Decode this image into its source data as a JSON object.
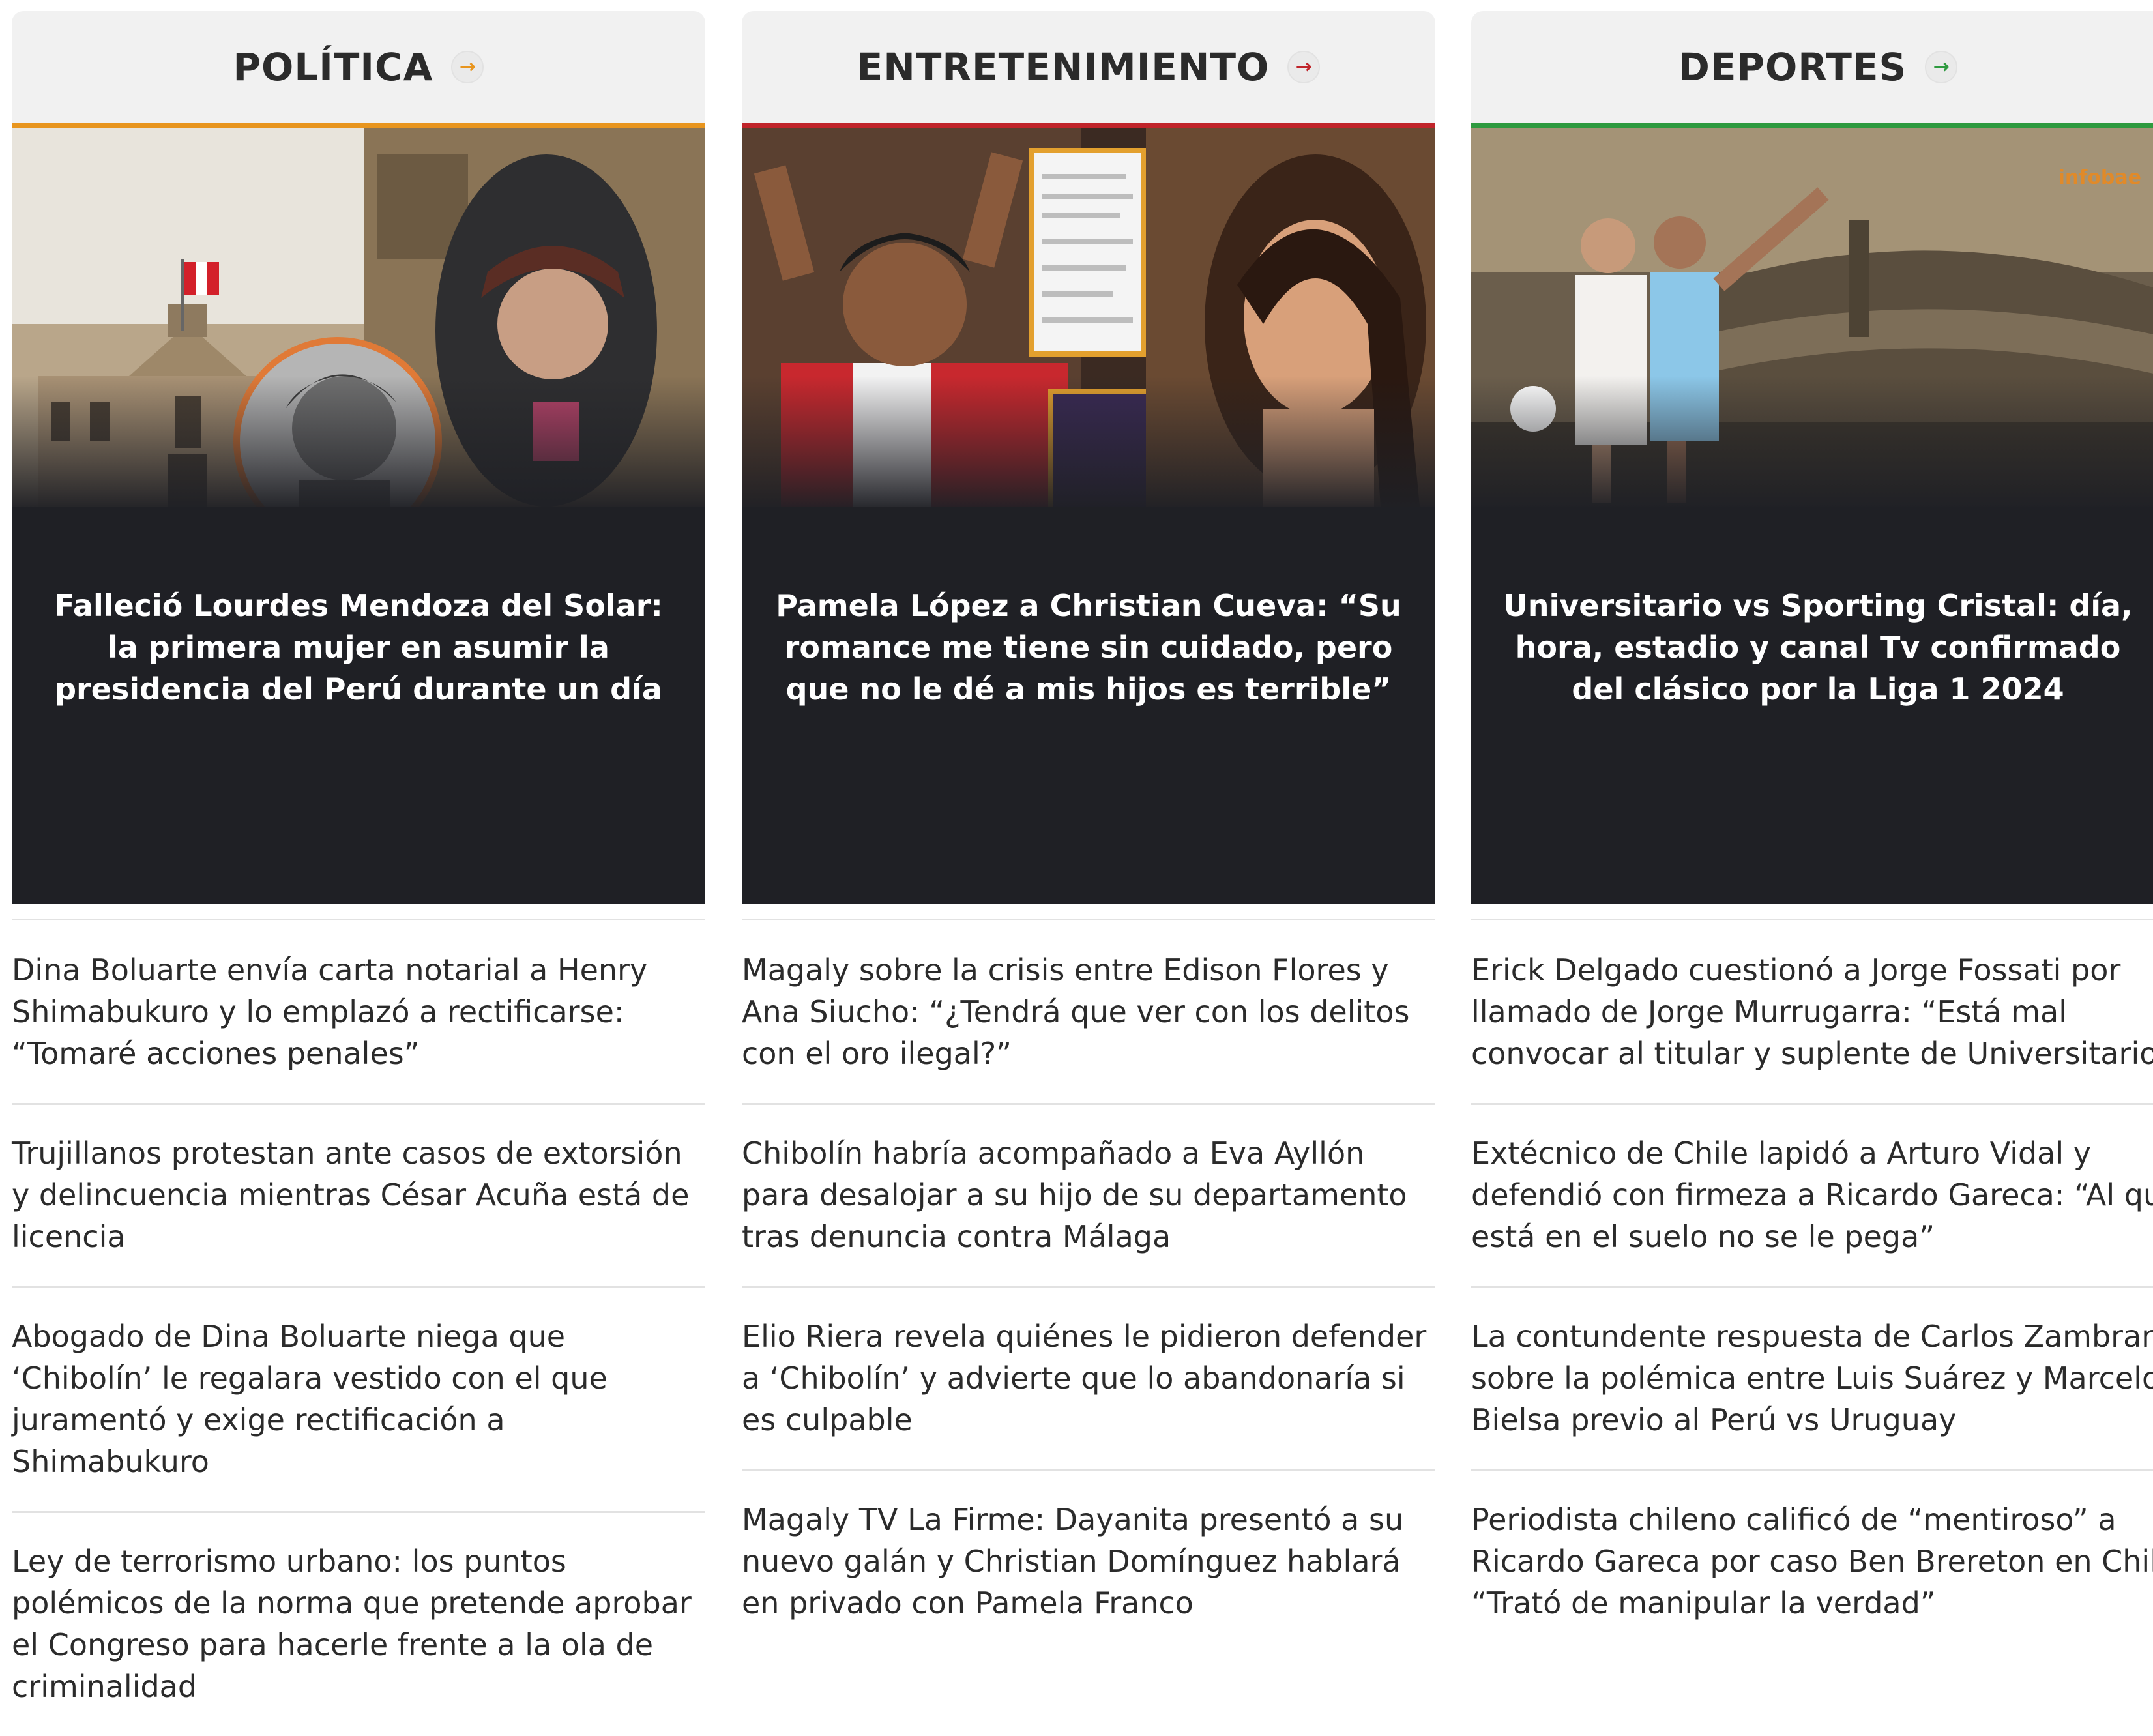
{
  "columns": [
    {
      "section": "POLÍTICA",
      "accent": "#e8951e",
      "hero_title": "Falleció Lourdes Mendoza del Solar: la primera mujer en asumir la presidencia del Perú durante un día",
      "stories": [
        "Dina Boluarte envía carta notarial a Henry Shimabukuro y lo emplazó a rectificarse: “Tomaré acciones penales”",
        "Trujillanos protestan ante casos de extorsión y delincuencia mientras César Acuña está de licencia",
        "Abogado de Dina Boluarte niega que ‘Chibolín’ le regalara vestido con el que juramentó y exige rectificación a Shimabukuro",
        "Ley de terrorismo urbano: los puntos polémicos de la norma que pretende aprobar el Congreso para hacerle frente a la ola de criminalidad"
      ]
    },
    {
      "section": "ENTRETENIMIENTO",
      "accent": "#c0242a",
      "hero_title": "Pamela López a Christian Cueva: “Su romance me tiene sin cuidado, pero que no le dé a mis hijos es terrible”",
      "stories": [
        "Magaly sobre la crisis entre Edison Flores y Ana Siucho: “¿Tendrá que ver con los delitos con el oro ilegal?”",
        "Chibolín habría acompañado a Eva Ayllón para desalojar a su hijo de su departamento tras denuncia contra Málaga",
        "Elio Riera revela quiénes le pidieron defender a ‘Chibolín’ y advierte que lo abandonaría si es culpable",
        "Magaly TV La Firme: Dayanita presentó a su nuevo galán y Christian Domínguez hablará en privado con Pamela Franco"
      ]
    },
    {
      "section": "DEPORTES",
      "accent": "#2e9a3f",
      "hero_title": "Universitario vs Sporting Cristal: día, hora, estadio y canal Tv confirmado del clásico por la Liga 1 2024",
      "hero_brand": "infobae",
      "stories": [
        "Erick Delgado cuestionó a Jorge Fossati por llamado de Jorge Murrugarra: “Está mal convocar al titular y suplente de Universitario”",
        "Extécnico de Chile lapidó a Arturo Vidal y defendió con firmeza a Ricardo Gareca: “Al que está en el suelo no se le pega”",
        "La contundente respuesta de Carlos Zambrano sobre la polémica entre Luis Suárez y Marcelo Bielsa previo al Perú vs Uruguay",
        "Periodista chileno calificó de “mentiroso” a Ricardo Gareca por caso Ben Brereton en Chile: “Trató de manipular la verdad”"
      ]
    }
  ],
  "icons": {
    "section_arrow": "arrow-right-icon"
  }
}
